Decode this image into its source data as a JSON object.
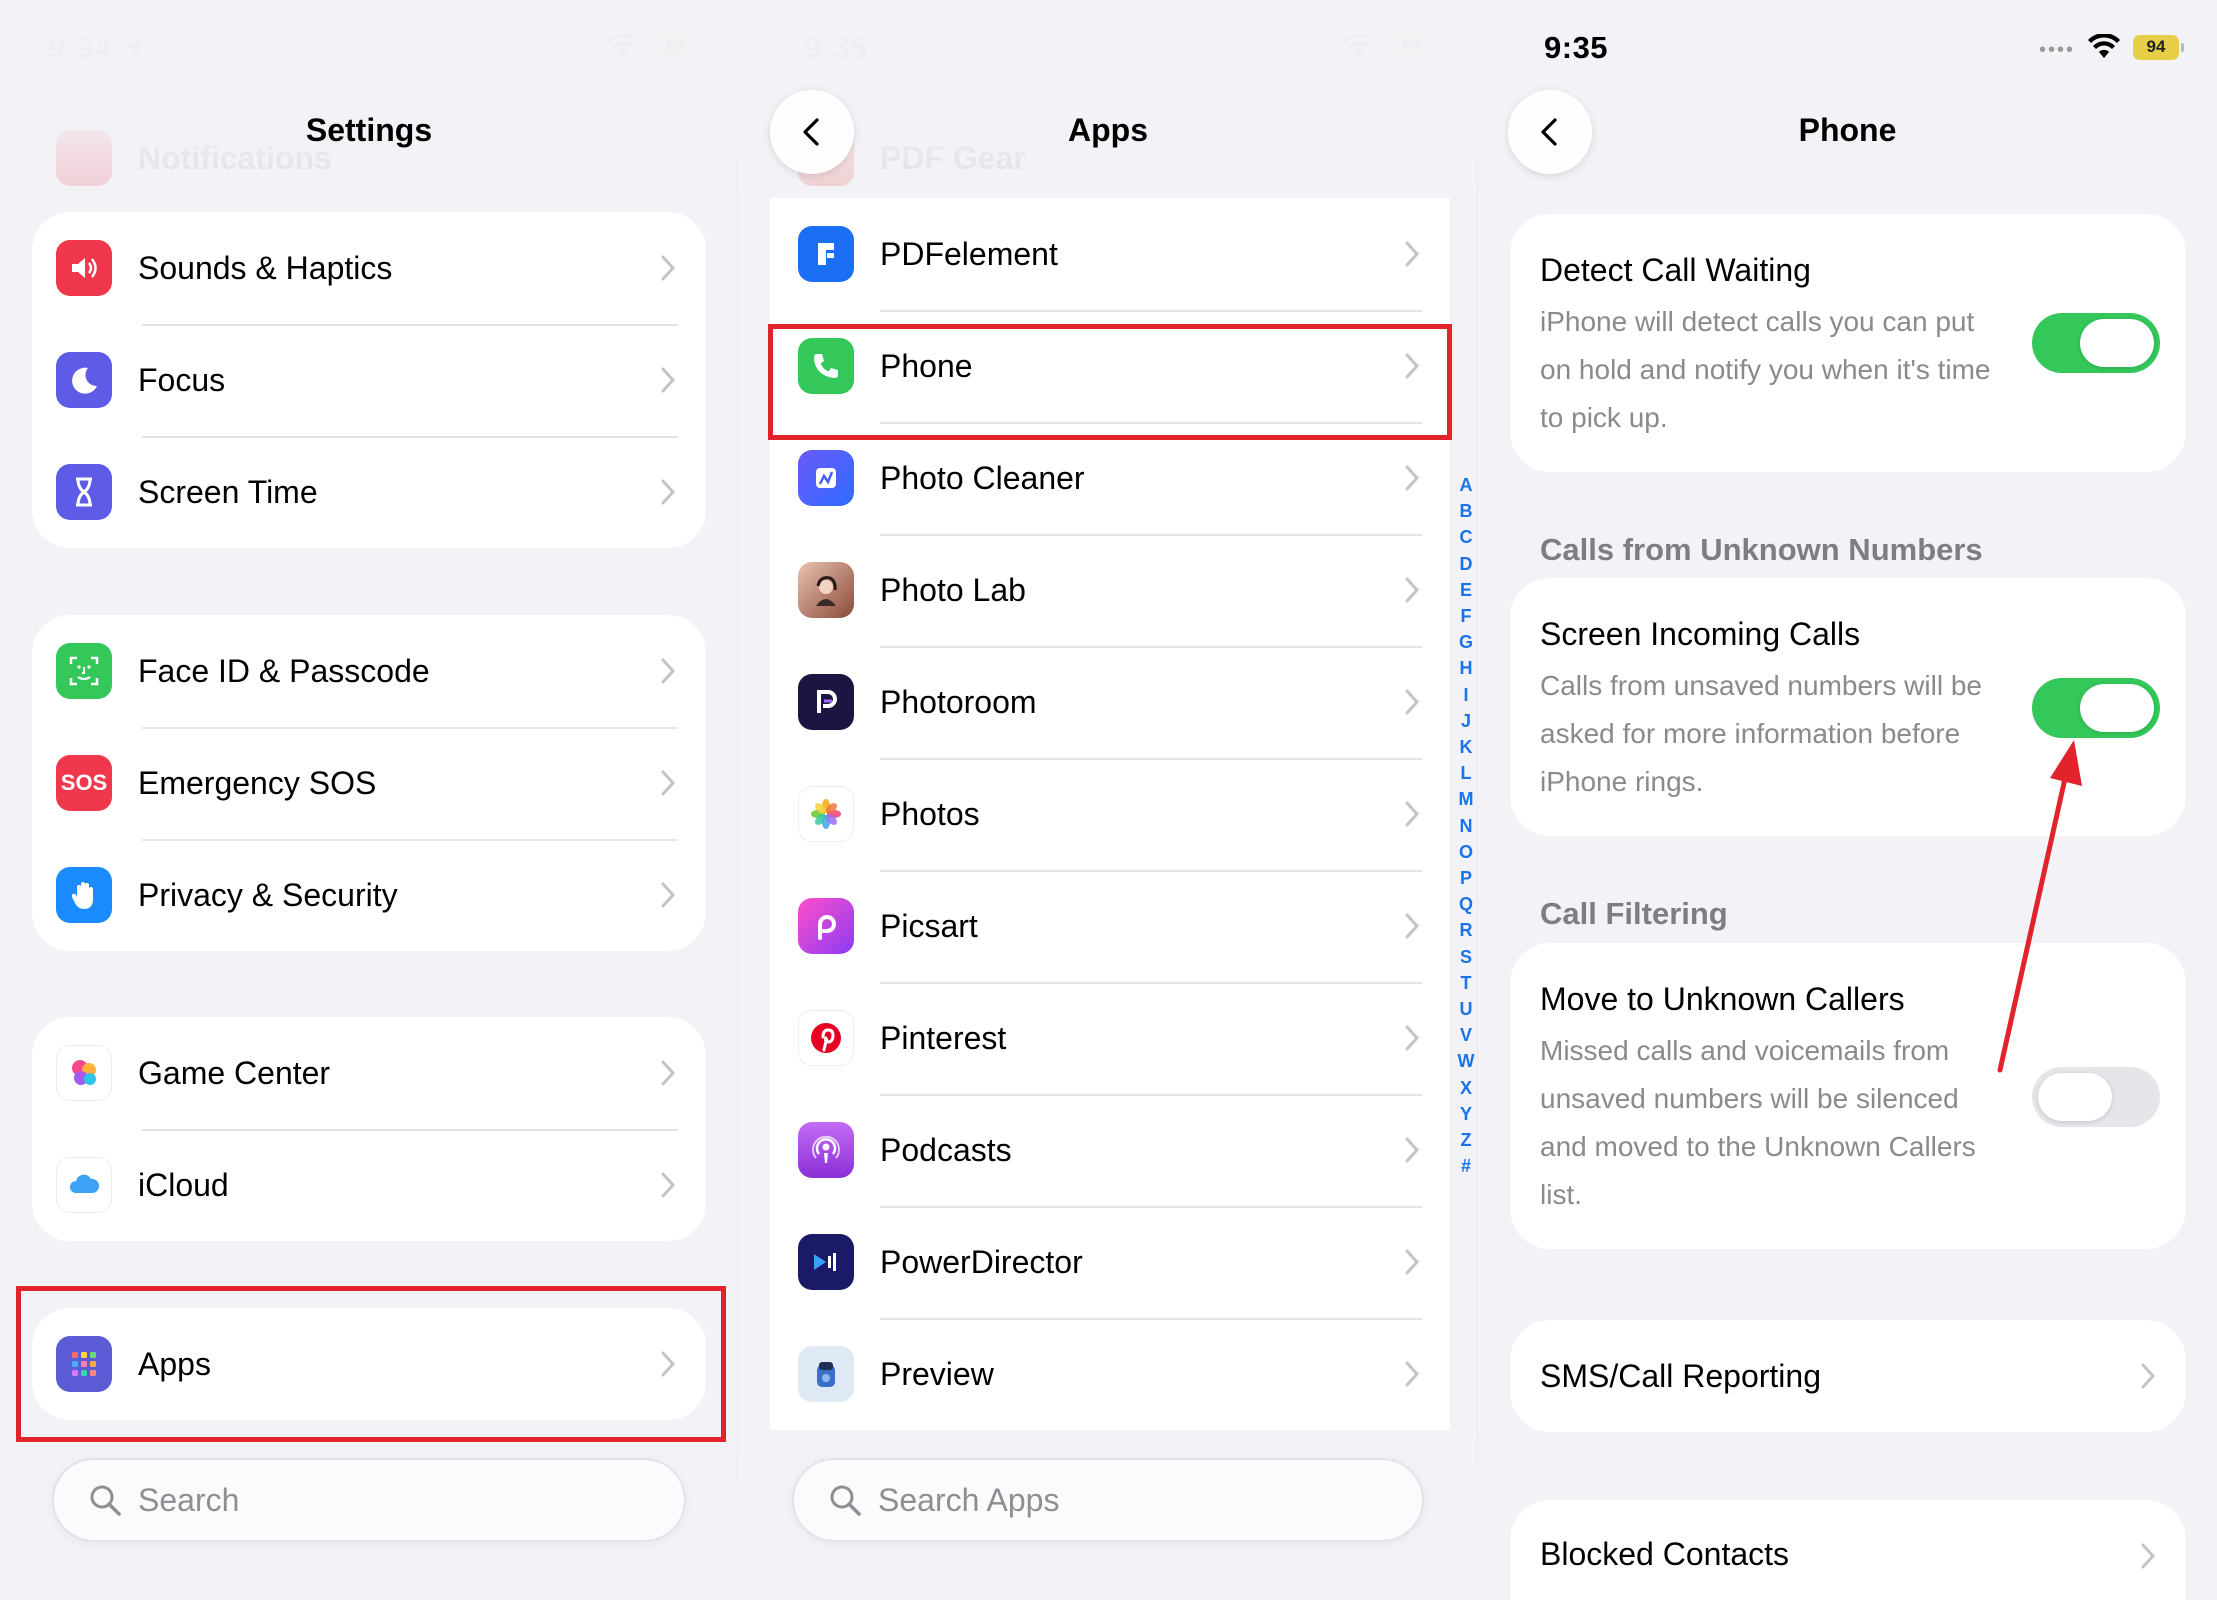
{
  "settings_panel": {
    "time": "9:34",
    "battery": "84",
    "title": "Settings",
    "ghost_item": "Notifications",
    "group1": [
      {
        "label": "Sounds & Haptics",
        "icon": "speaker-icon",
        "color": "#f0374c"
      },
      {
        "label": "Focus",
        "icon": "moon-icon",
        "color": "#5e5ce6"
      },
      {
        "label": "Screen Time",
        "icon": "hourglass-icon",
        "color": "#5e5ce6"
      }
    ],
    "group2": [
      {
        "label": "Face ID & Passcode",
        "icon": "face-id-icon",
        "color": "#34c759"
      },
      {
        "label": "Emergency SOS",
        "icon": "sos-icon",
        "color": "#f0374c",
        "text": "SOS"
      },
      {
        "label": "Privacy & Security",
        "icon": "hand-icon",
        "color": "#1a8cff"
      }
    ],
    "group3": [
      {
        "label": "Game Center",
        "icon": "game-center-icon",
        "color": "#ffffff"
      },
      {
        "label": "iCloud",
        "icon": "cloud-icon",
        "color": "#ffffff"
      }
    ],
    "apps_item": {
      "label": "Apps",
      "icon": "apps-grid-icon",
      "color": "#5b5bd6"
    },
    "search_placeholder": "Search"
  },
  "apps_panel": {
    "time": "9:35",
    "battery": "94",
    "title": "Apps",
    "ghost_item": "PDF Gear",
    "items": [
      {
        "label": "PDFelement",
        "icon": "pdfelement-icon",
        "color": "#1a6ff5"
      },
      {
        "label": "Phone",
        "icon": "phone-icon",
        "color": "#34c759"
      },
      {
        "label": "Photo Cleaner",
        "icon": "photo-cleaner-icon",
        "color": "#4b5cf0"
      },
      {
        "label": "Photo Lab",
        "icon": "photo-lab-icon",
        "color": "#c98d7a"
      },
      {
        "label": "Photoroom",
        "icon": "photoroom-icon",
        "color": "#1b1541"
      },
      {
        "label": "Photos",
        "icon": "photos-icon",
        "color": "#ffffff"
      },
      {
        "label": "Picsart",
        "icon": "picsart-icon",
        "color": "#b13cf0"
      },
      {
        "label": "Pinterest",
        "icon": "pinterest-icon",
        "color": "#ffffff"
      },
      {
        "label": "Podcasts",
        "icon": "podcasts-icon",
        "color": "#9b3fe0"
      },
      {
        "label": "PowerDirector",
        "icon": "powerdirector-icon",
        "color": "#1b1a66"
      },
      {
        "label": "Preview",
        "icon": "preview-icon",
        "color": "#dfe8f5"
      }
    ],
    "index_letters": [
      "A",
      "B",
      "C",
      "D",
      "E",
      "F",
      "G",
      "H",
      "I",
      "J",
      "K",
      "L",
      "M",
      "N",
      "O",
      "P",
      "Q",
      "R",
      "S",
      "T",
      "U",
      "V",
      "W",
      "X",
      "Y",
      "Z",
      "#"
    ],
    "search_placeholder": "Search Apps"
  },
  "phone_panel": {
    "time": "9:35",
    "battery": "94",
    "title": "Phone",
    "detect_call_waiting": {
      "title": "Detect Call Waiting",
      "desc_lines": [
        "iPhone will detect calls you can put",
        "on hold and notify you when it's time",
        "to pick up."
      ],
      "on": true
    },
    "section_unknown": "Calls from Unknown Numbers",
    "screen_incoming": {
      "title": "Screen Incoming Calls",
      "desc_lines": [
        "Calls from unsaved numbers will be",
        "asked for more information before",
        "iPhone rings."
      ],
      "on": true
    },
    "section_filtering": "Call Filtering",
    "move_unknown": {
      "title": "Move to Unknown Callers",
      "desc_lines": [
        "Missed calls and voicemails from",
        "unsaved numbers will be silenced",
        "and moved to the Unknown Callers",
        "list."
      ],
      "on": false
    },
    "sms_reporting": "SMS/Call Reporting",
    "blocked_contacts": "Blocked Contacts"
  },
  "colors": {
    "highlight": "#e1232b",
    "toggle_on": "#34c759",
    "index_blue": "#1a73e8"
  }
}
